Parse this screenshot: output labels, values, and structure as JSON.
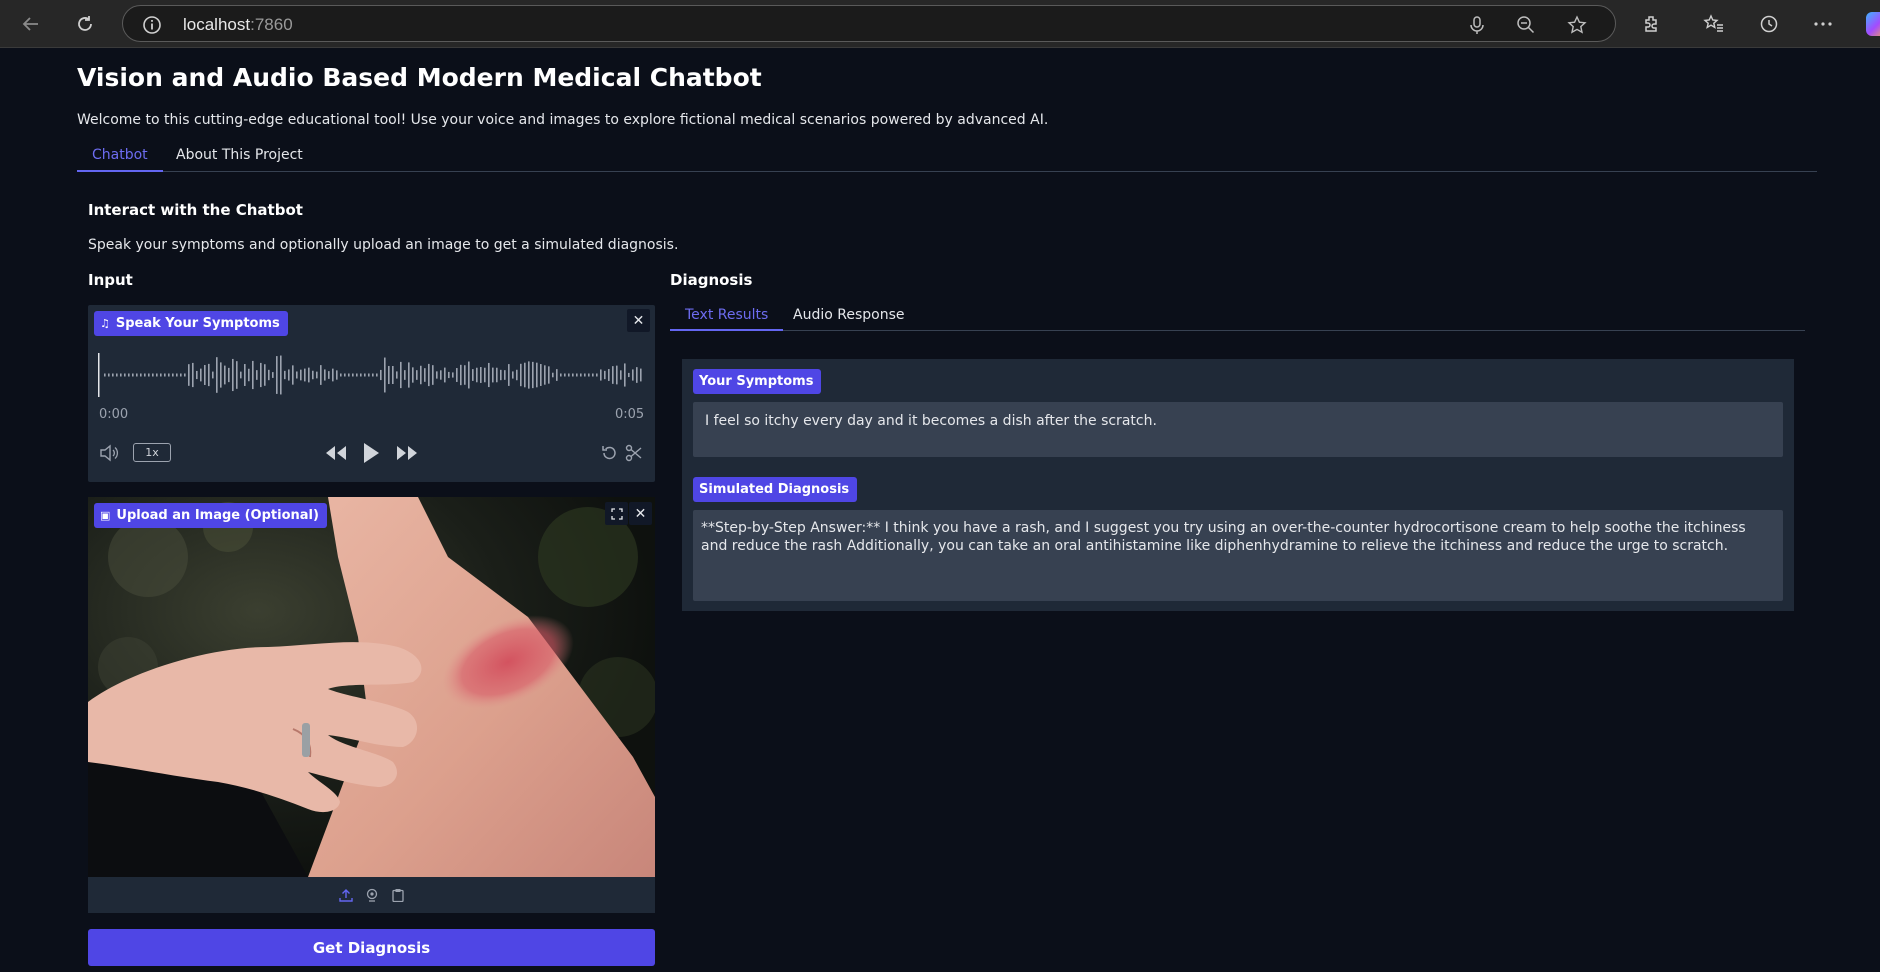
{
  "browser": {
    "url_host": "localhost",
    "url_port": ":7860"
  },
  "page": {
    "title": "Vision and Audio Based Modern Medical Chatbot",
    "description": "Welcome to this cutting-edge educational tool! Use your voice and images to explore fictional medical scenarios powered by advanced AI.",
    "tabs": [
      {
        "label": "Chatbot",
        "active": true
      },
      {
        "label": "About This Project",
        "active": false
      }
    ]
  },
  "chatbot": {
    "section_title": "Interact with the Chatbot",
    "section_desc": "Speak your symptoms and optionally upload an image to get a simulated diagnosis.",
    "input_label": "Input",
    "audio": {
      "label": "Speak Your Symptoms",
      "time_start": "0:00",
      "time_end": "0:05",
      "speed": "1x"
    },
    "image": {
      "label": "Upload an Image (Optional)"
    },
    "submit_label": "Get Diagnosis"
  },
  "diagnosis": {
    "label": "Diagnosis",
    "tabs": [
      {
        "label": "Text Results",
        "active": true
      },
      {
        "label": "Audio Response",
        "active": false
      }
    ],
    "symptoms_label": "Your Symptoms",
    "symptoms_text": "I feel so itchy every day and it becomes a dish after the scratch.",
    "simulated_label": "Simulated Diagnosis",
    "simulated_text": "**Step-by-Step Answer:** I think you have a rash, and I suggest you try using an over-the-counter hydrocortisone cream to help soothe the itchiness and reduce the rash Additionally, you can take an oral antihistamine like diphenhydramine to relieve the itchiness and reduce the urge to scratch."
  },
  "colors": {
    "background": "#0b0f19",
    "accent": "#4f46e5",
    "panel": "#1f2937",
    "field": "#374151"
  }
}
